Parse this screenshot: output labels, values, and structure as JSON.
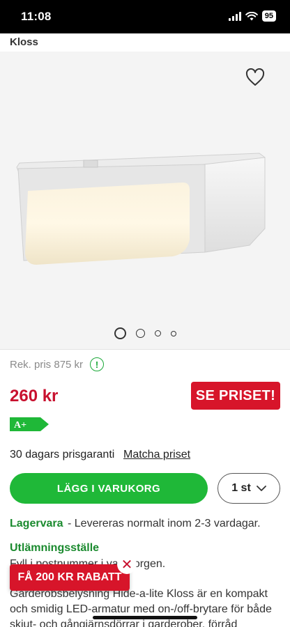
{
  "status": {
    "time": "11:08",
    "battery": "95"
  },
  "product": {
    "title": "Kloss",
    "rek_price": "Rek. pris 875 kr",
    "info_symbol": "!",
    "price": "260 kr",
    "see_price_button": "SE PRISET!",
    "energy_class": "A+",
    "price_guarantee": "30 dagars prisgaranti",
    "match_price_link": "Matcha priset",
    "add_to_cart_button": "LÄGG I VARUKORG",
    "quantity": "1 st",
    "stock_label": "Lagervara",
    "stock_text": "- Levereras normalt inom 2-3 vardagar.",
    "pickup_label": "Utlämningsställe",
    "pickup_text": "Fyll i postnummer i varukorgen.",
    "description": "Garderobsbelysning Hide-a-lite Kloss är en kompakt och smidig LED-armatur med on-/off-brytare för både skjut- och gångjärnsdörrar i garderober, förråd"
  },
  "gallery": {
    "image_count": 4,
    "active_index": 0
  },
  "promo": {
    "label": "FÅ 200 KR RABATT",
    "close_symbol": "✕"
  },
  "colors": {
    "accent_red": "#d7152a",
    "accent_green": "#1fb838",
    "text_green": "#1a8a2e"
  }
}
